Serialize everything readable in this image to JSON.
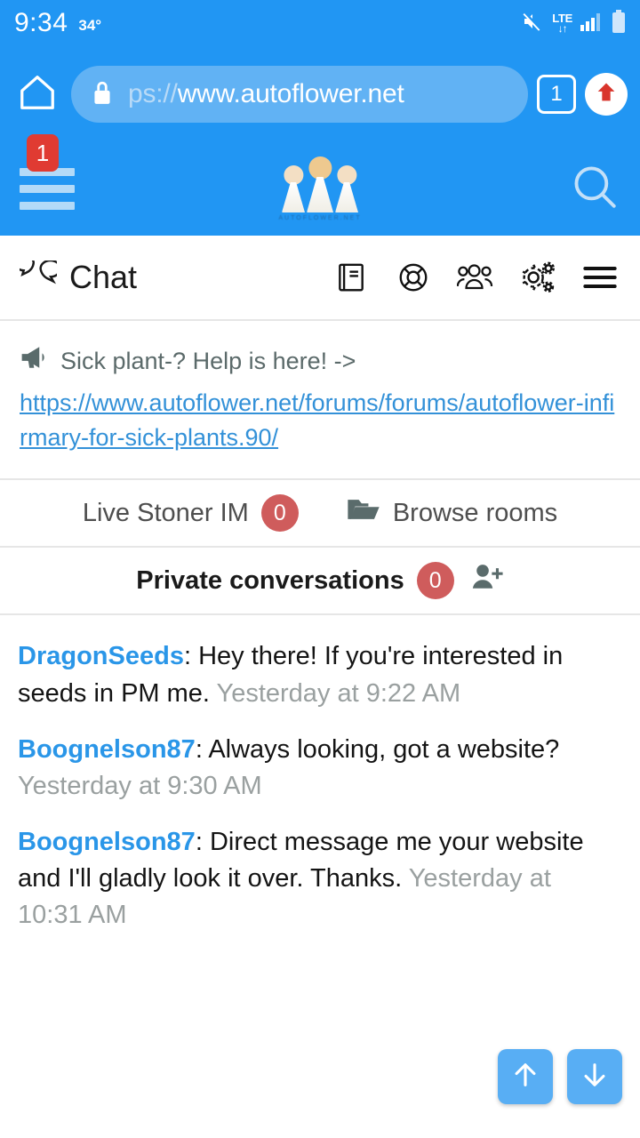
{
  "status_bar": {
    "time": "9:34",
    "temperature": "34°",
    "network_type": "LTE",
    "data_arrows": "↓↑",
    "icons": [
      "volume-mute-icon",
      "lte-icon",
      "signal-bars-icon",
      "battery-icon"
    ]
  },
  "browser": {
    "home_icon": "home-icon",
    "lock_icon": "lock-icon",
    "url_prefix": "ps://",
    "url_main": "www.autoflower.net",
    "url_full": "ps://www.autoflower.net",
    "tab_count": "1",
    "upload_icon": "upload-arrow-icon"
  },
  "site_header": {
    "menu_badge": "1",
    "menu_icon": "hamburger-menu-icon",
    "logo_alt": "autoflower-logo",
    "logo_subtext": "AUTOFLOWER.NET",
    "search_icon": "search-icon"
  },
  "chat_page": {
    "title": "Chat",
    "title_icon": "chat-bubbles-icon",
    "toolbar_icons": [
      {
        "name": "rules-book-icon",
        "glyph": "book"
      },
      {
        "name": "help-lifering-icon",
        "glyph": "lifering"
      },
      {
        "name": "members-users-icon",
        "glyph": "users"
      },
      {
        "name": "chat-settings-gears-icon",
        "glyph": "gears"
      },
      {
        "name": "chat-options-menu-icon",
        "glyph": "hamburger"
      }
    ]
  },
  "announcement": {
    "icon": "megaphone-icon",
    "text": "Sick plant-? Help is here! ->",
    "link": "https://www.autoflower.net/forums/forums/autoflower-infirmary-for-sick-plants.90/"
  },
  "rooms_row": {
    "live_label": "Live Stoner IM",
    "live_count": "0",
    "browse_icon": "folder-open-icon",
    "browse_label": "Browse rooms"
  },
  "private_row": {
    "label": "Private conversations",
    "count": "0",
    "add_icon": "add-user-icon"
  },
  "messages": [
    {
      "user": "DragonSeeds",
      "separator": ": ",
      "text": "Hey there! If you're interested in seeds in PM me.",
      "time": "Yesterday at 9:22 AM"
    },
    {
      "user": "Boognelson87",
      "separator": ": ",
      "text": "Always looking, got a website?",
      "time": "Yesterday at 9:30 AM"
    },
    {
      "user": "Boognelson87",
      "separator": ": ",
      "text": "Direct message me your website and I'll gladly look it over. Thanks.",
      "time": "Yesterday at 10:31 AM"
    }
  ],
  "scroll_buttons": {
    "up_icon": "arrow-up-icon",
    "down_icon": "arrow-down-icon"
  },
  "colors": {
    "brand_blue": "#2196f3",
    "url_pill_blue": "#61b2f4",
    "link_blue": "#3391d8",
    "username_blue": "#2a96e8",
    "badge_red": "#cf5c5c",
    "menu_badge_red": "#e03b32",
    "fab_blue": "#58aef4",
    "muted_text": "#9aa0a0"
  }
}
